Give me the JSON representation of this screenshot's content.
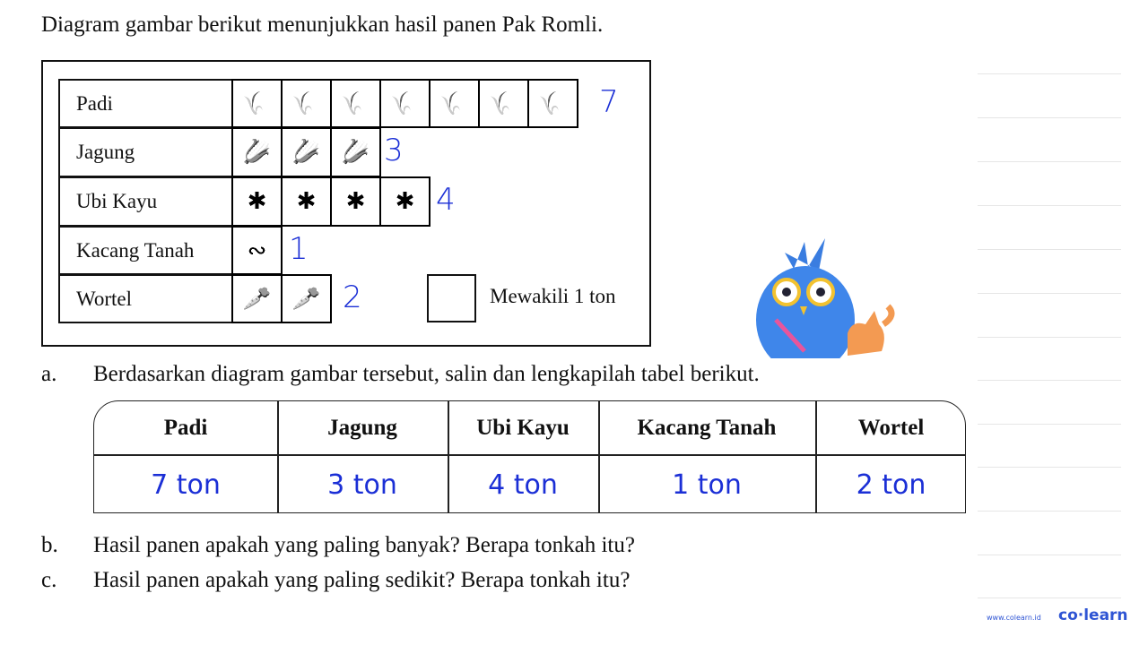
{
  "title": "Diagram gambar berikut menunjukkan hasil panen Pak Romli.",
  "pictogram": {
    "rows": [
      {
        "label": "Padi",
        "count": 7,
        "icon": "rice-icon",
        "glyph": "🌾",
        "answer": "7"
      },
      {
        "label": "Jagung",
        "count": 3,
        "icon": "corn-icon",
        "glyph": "🌽",
        "answer": "3"
      },
      {
        "label": "Ubi Kayu",
        "count": 4,
        "icon": "cassava-icon",
        "glyph": "✱",
        "answer": "4"
      },
      {
        "label": "Kacang Tanah",
        "count": 1,
        "icon": "peanut-icon",
        "glyph": "∾",
        "answer": "1"
      },
      {
        "label": "Wortel",
        "count": 2,
        "icon": "carrot-icon",
        "glyph": "🥕",
        "answer": "2"
      }
    ],
    "legend": "Mewakili 1 ton"
  },
  "question_a": {
    "letter": "a.",
    "text": "Berdasarkan diagram gambar tersebut, salin dan lengkapilah tabel berikut."
  },
  "table": {
    "headers": [
      "Padi",
      "Jagung",
      "Ubi Kayu",
      "Kacang Tanah",
      "Wortel"
    ],
    "values": [
      "7 ton",
      "3 ton",
      "4 ton",
      "1 ton",
      "2 ton"
    ]
  },
  "question_b": {
    "letter": "b.",
    "text": "Hasil panen apakah yang paling banyak? Berapa tonkah itu?"
  },
  "question_c": {
    "letter": "c.",
    "text": "Hasil panen apakah yang paling sedikit? Berapa tonkah itu?"
  },
  "brand": {
    "url": "www.colearn.id",
    "logo": "co·learn",
    "color": "#2f55d4"
  },
  "colors": {
    "handwriting": "#1b2fd6"
  }
}
